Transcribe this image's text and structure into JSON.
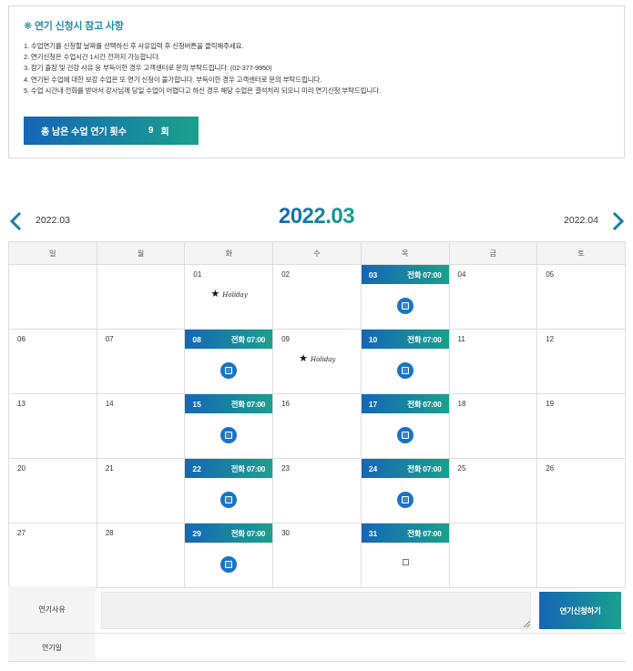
{
  "notice": {
    "title": "❋ 연기 신청시 참고 사항",
    "lines": [
      "1. 수업연기를 신청할 날짜를 선택하신 후 사유입력 후 신청버튼을 클릭해주세요.",
      "2. 연기신청은 수업시간 1시간 전까지 가능합니다.",
      "3. 장기 출장 및 건강 사유 등 부득이한 경우 고객센터로 문의 부탁드립니다. (02-377-9950)",
      "4. 연기된 수업에 대한 보강 수업은 또 연기 신청이 불가합니다. 부득이한 경우 고객센터로 문의 부탁드립니다.",
      "5. 수업 시간내 전화를 받아서 강사님께 당일 수업이 어렵다고 하신 경우 해당 수업은 결석처리 되오니 미리 연기신청 부탁드립니다."
    ],
    "remaining_label": "총 남은 수업 연기 횟수",
    "remaining_count": "9",
    "remaining_unit": "회"
  },
  "calendar": {
    "prev_label": "2022.03",
    "next_label": "2022.04",
    "title": "2022.03",
    "weekdays": [
      "일",
      "월",
      "화",
      "수",
      "목",
      "금",
      "토"
    ],
    "holiday_text": "Holiday",
    "weeks": [
      [
        "",
        "",
        "01",
        "02",
        "03",
        "04",
        "05"
      ],
      [
        "06",
        "07",
        "08",
        "09",
        "10",
        "11",
        "12"
      ],
      [
        "13",
        "14",
        "15",
        "16",
        "17",
        "18",
        "19"
      ],
      [
        "20",
        "21",
        "22",
        "23",
        "24",
        "25",
        "26"
      ],
      [
        "27",
        "28",
        "29",
        "30",
        "31",
        "",
        ""
      ]
    ],
    "lessons": [
      {
        "day": "03",
        "label": "전화 07:00"
      },
      {
        "day": "08",
        "label": "전화 07:00"
      },
      {
        "day": "10",
        "label": "전화 07:00"
      },
      {
        "day": "15",
        "label": "전화 07:00"
      },
      {
        "day": "17",
        "label": "전화 07:00"
      },
      {
        "day": "22",
        "label": "전화 07:00"
      },
      {
        "day": "24",
        "label": "전화 07:00"
      },
      {
        "day": "29",
        "label": "전화 07:00"
      },
      {
        "day": "31",
        "label": "전화 07:00"
      }
    ],
    "checkbox_days": [
      "31"
    ],
    "holidays": [
      "01",
      "09"
    ]
  },
  "form": {
    "reason_label": "연기사유",
    "reason_value": "",
    "submit_label": "연기신청하기",
    "date_label": "연기일",
    "date_value": ""
  },
  "colors": {
    "accent_start": "#1566b6",
    "accent_end": "#1aa08c",
    "title_color": "#1e8fa8"
  }
}
